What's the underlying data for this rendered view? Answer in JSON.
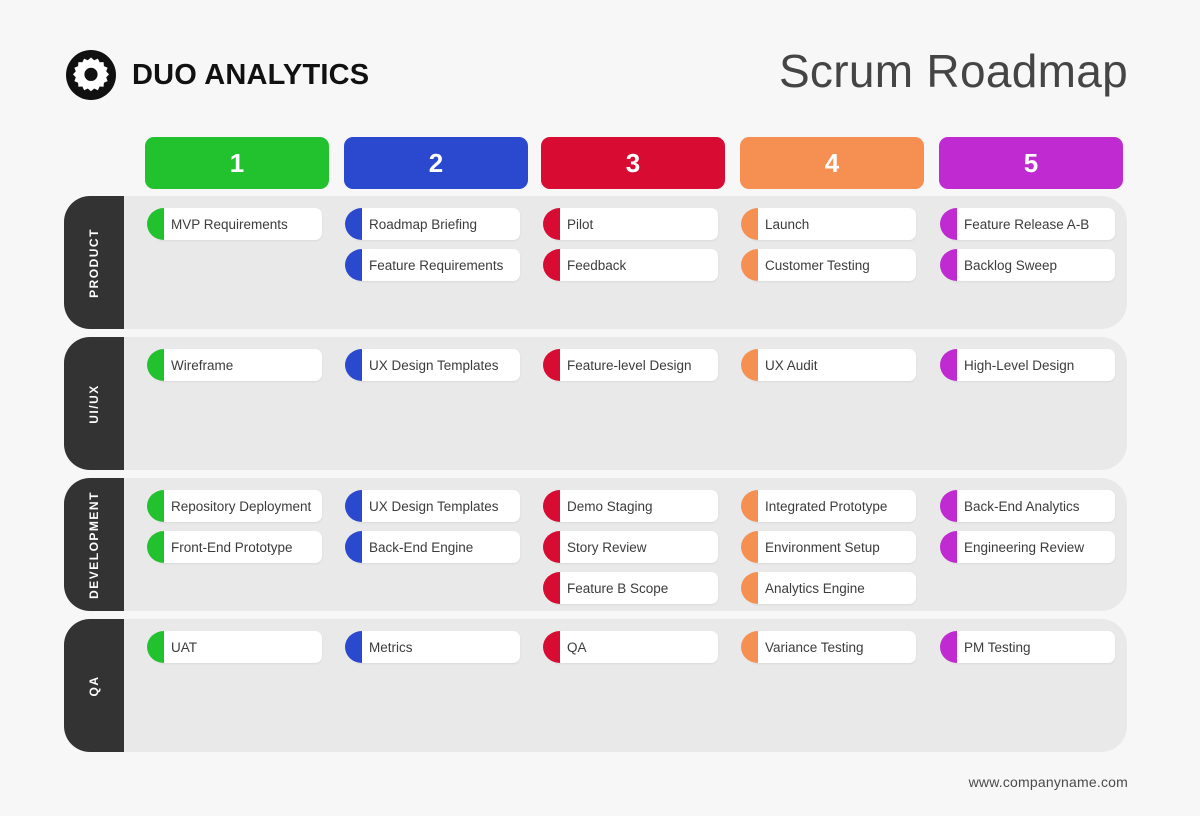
{
  "brand": {
    "name": "DUO ANALYTICS",
    "logo_icon": "gear-icon"
  },
  "header": {
    "title": "Scrum Roadmap"
  },
  "footer": {
    "website": "www.companyname.com"
  },
  "palette": {
    "sprint1": "#22C12E",
    "sprint2": "#2B49CE",
    "sprint3": "#D80B33",
    "sprint4": "#F59052",
    "sprint5": "#BF2BD0",
    "band_bg": "#E9E9E9",
    "tab_bg": "#333333",
    "page_bg": "#F7F7F7",
    "card_bg": "#FFFFFF",
    "text": "#3C3C3C"
  },
  "sprints": [
    {
      "label": "1",
      "color": "#22C12E"
    },
    {
      "label": "2",
      "color": "#2B49CE"
    },
    {
      "label": "3",
      "color": "#D80B33"
    },
    {
      "label": "4",
      "color": "#F59052"
    },
    {
      "label": "5",
      "color": "#BF2BD0"
    }
  ],
  "lanes": [
    {
      "label": "PRODUCT",
      "columns": [
        [
          "MVP Requirements"
        ],
        [
          "Roadmap Briefing",
          "Feature Requirements"
        ],
        [
          "Pilot",
          "Feedback"
        ],
        [
          "Launch",
          "Customer Testing"
        ],
        [
          "Feature Release A-B",
          "Backlog Sweep"
        ]
      ]
    },
    {
      "label": "UI/UX",
      "columns": [
        [
          "Wireframe"
        ],
        [
          "UX Design Templates"
        ],
        [
          "Feature-level Design"
        ],
        [
          "UX Audit"
        ],
        [
          "High-Level Design"
        ]
      ]
    },
    {
      "label": "DEVELOPMENT",
      "columns": [
        [
          "Repository Deployment",
          "Front-End Prototype"
        ],
        [
          "UX Design Templates",
          "Back-End Engine"
        ],
        [
          "Demo Staging",
          "Story Review",
          "Feature B Scope"
        ],
        [
          "Integrated Prototype",
          "Environment Setup",
          "Analytics Engine"
        ],
        [
          "Back-End Analytics",
          "Engineering Review"
        ]
      ]
    },
    {
      "label": "QA",
      "columns": [
        [
          "UAT"
        ],
        [
          "Metrics"
        ],
        [
          "QA"
        ],
        [
          "Variance Testing"
        ],
        [
          "PM Testing"
        ]
      ]
    }
  ]
}
